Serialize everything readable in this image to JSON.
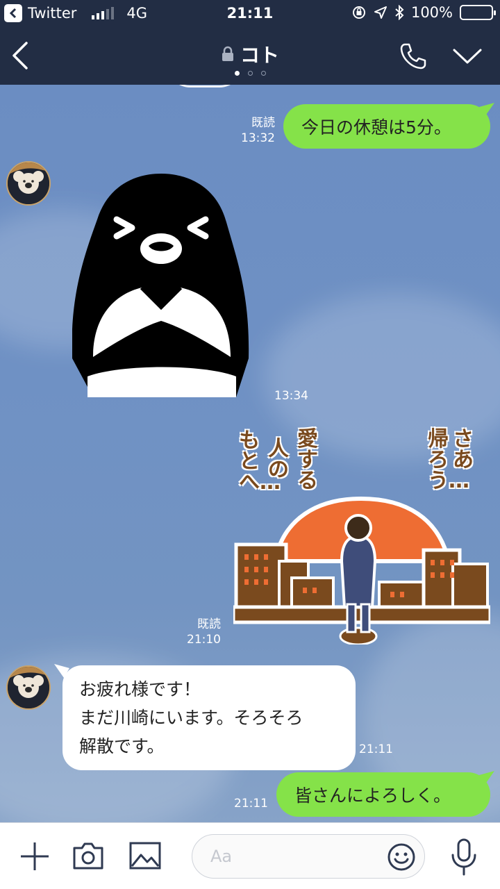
{
  "status_bar": {
    "carrier_app": "Twitter",
    "network": "4G",
    "time": "21:11",
    "battery": "100%",
    "battery_level": 1.0
  },
  "header": {
    "title": "コト",
    "page_indicator": {
      "count": 3,
      "active": 0
    }
  },
  "messages": [
    {
      "type": "text",
      "direction": "out",
      "text": "今日の休憩は5分。",
      "read_label": "既読",
      "time": "13:32"
    },
    {
      "type": "sticker",
      "direction": "in",
      "sticker": "penguin-crossed-arms-sticker",
      "time": "13:34"
    },
    {
      "type": "sticker",
      "direction": "out",
      "sticker": "sunset-going-home-sticker",
      "sticker_text": {
        "col1": "さあ",
        "col2": "帰ろう…",
        "col3": "愛する",
        "col4": "人の",
        "col5": "もとへ…"
      },
      "read_label": "既読",
      "time": "21:10"
    },
    {
      "type": "text",
      "direction": "in",
      "lines": [
        "お疲れ様です！",
        "まだ川崎にいます。そろそろ",
        "解散です。"
      ],
      "time": "21:11"
    },
    {
      "type": "text",
      "direction": "out",
      "text": "皆さんによろしく。",
      "time": "21:11"
    }
  ],
  "input_bar": {
    "placeholder": "Aa"
  },
  "colors": {
    "header_bg": "#222d44",
    "bubble_out": "#85e249",
    "bubble_in": "#ffffff",
    "chat_bg": "#6d8fbf"
  }
}
